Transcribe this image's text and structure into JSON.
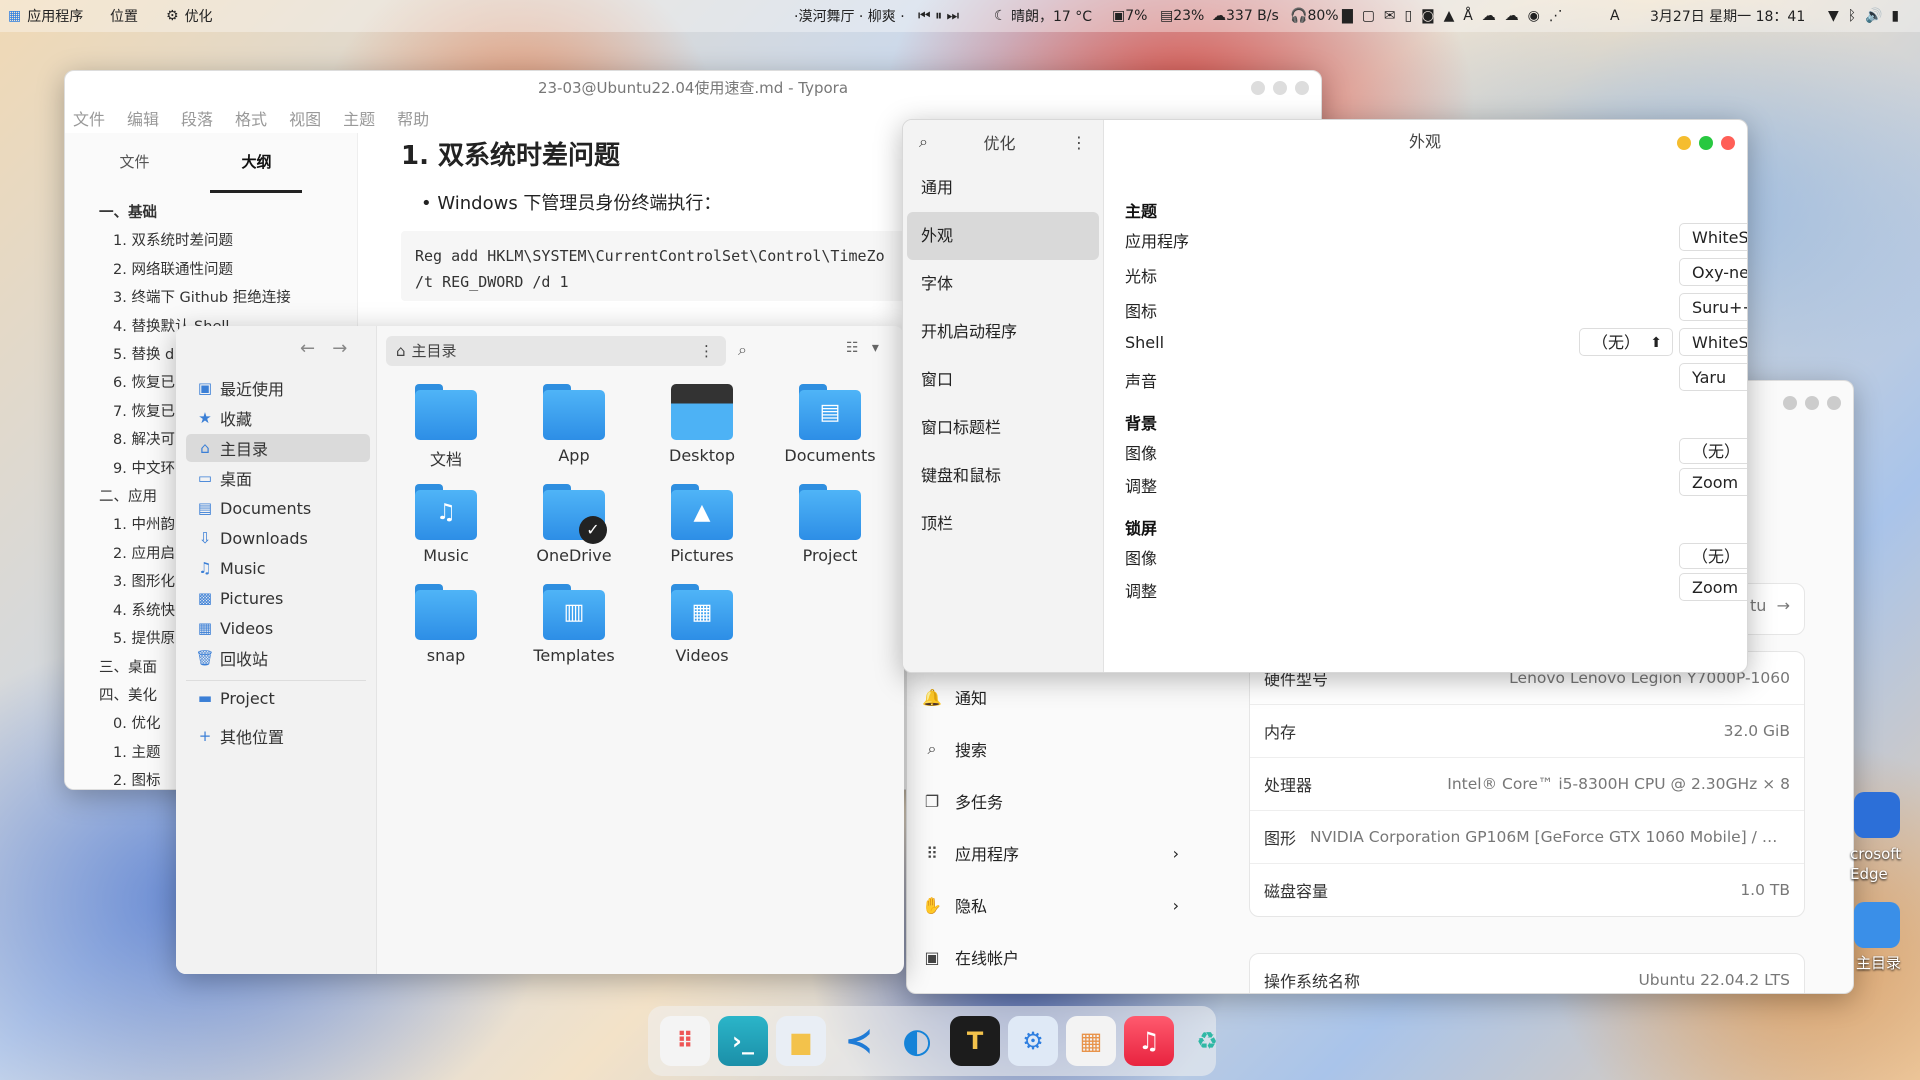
{
  "topbar": {
    "apps": "应用程序",
    "places": "位置",
    "tweaks": "优化",
    "media": "·漠河舞厅 · 柳爽 ·",
    "weather": "晴朗，17 °C",
    "cpu": "7%",
    "mem": "23%",
    "net": "337 B/s",
    "headset": "80%",
    "kbd": "A",
    "datetime": "3月27日 星期一 18：41"
  },
  "typora": {
    "title": "23-03@Ubuntu22.04使用速查.md - Typora",
    "menu": [
      "文件",
      "编辑",
      "段落",
      "格式",
      "视图",
      "主题",
      "帮助"
    ],
    "tabs": [
      "文件",
      "大纲"
    ],
    "toc": [
      "一、基础",
      "1. 双系统时差问题",
      "2. 网络联通性问题",
      "3. 终端下 Github 拒绝连接",
      "4. 替换默认 Shell",
      "5. 替换 d",
      "6. 恢复已",
      "7. 恢复已",
      "8. 解决可",
      "9. 中文环",
      "二、应用",
      "1. 中州韵",
      "2. 应用启",
      "3. 图形化",
      "4. 系统快",
      "5. 提供原",
      "三、桌面",
      "四、美化",
      "0. 优化",
      "1. 主题",
      "2. 图标"
    ],
    "heading": "1. 双系统时差问题",
    "bullet": "Windows 下管理员身份终端执行：",
    "code1": "Reg add HKLM\\SYSTEM\\CurrentControlSet\\Control\\TimeZo",
    "code2": "/t REG_DWORD /d 1"
  },
  "files": {
    "location": "主目录",
    "side": [
      "最近使用",
      "收藏",
      "主目录",
      "桌面",
      "Documents",
      "Downloads",
      "Music",
      "Pictures",
      "Videos",
      "回收站",
      "Project",
      "其他位置"
    ],
    "folders": [
      "文档",
      "App",
      "Desktop",
      "Documents",
      "Music",
      "OneDrive",
      "Pictures",
      "Project",
      "snap",
      "Templates",
      "Videos"
    ]
  },
  "tweaks": {
    "title": "优化",
    "panel": "外观",
    "nav": [
      "通用",
      "外观",
      "字体",
      "开机启动程序",
      "窗口",
      "窗口标题栏",
      "键盘和鼠标",
      "顶栏"
    ],
    "sec_theme": "主题",
    "sec_bg": "背景",
    "sec_lock": "锁屏",
    "rows": {
      "app": "应用程序",
      "cursor": "光标",
      "icons": "图标",
      "shell": "Shell",
      "sound": "声音",
      "image": "图像",
      "adjust": "调整"
    },
    "vals": {
      "app": "WhiteSur-Light-solid",
      "cursor": "Oxy-neon",
      "icons": "Suru++-Light",
      "shell": "WhiteSur-Light-solid",
      "sound": "Yaru",
      "none": "（无）",
      "zoom": "Zoom"
    }
  },
  "settings": {
    "nav": [
      "通知",
      "搜索",
      "多任务",
      "应用程序",
      "隐私",
      "在线帐户"
    ],
    "info": [
      [
        "硬件型号",
        "Lenovo Lenovo Legion Y7000P-1060"
      ],
      [
        "内存",
        "32.0 GiB"
      ],
      [
        "处理器",
        "Intel® Core™ i5-8300H CPU @ 2.30GHz × 8"
      ],
      [
        "图形",
        "NVIDIA Corporation GP106M [GeForce GTX 1060 Mobile] / Mesa I..."
      ],
      [
        "磁盘容量",
        "1.0 TB"
      ]
    ],
    "os": [
      "操作系统名称",
      "Ubuntu 22.04.2 LTS"
    ],
    "partial": "tu"
  },
  "desktop": {
    "edge": "crosoft Edge",
    "home": "主目录"
  }
}
